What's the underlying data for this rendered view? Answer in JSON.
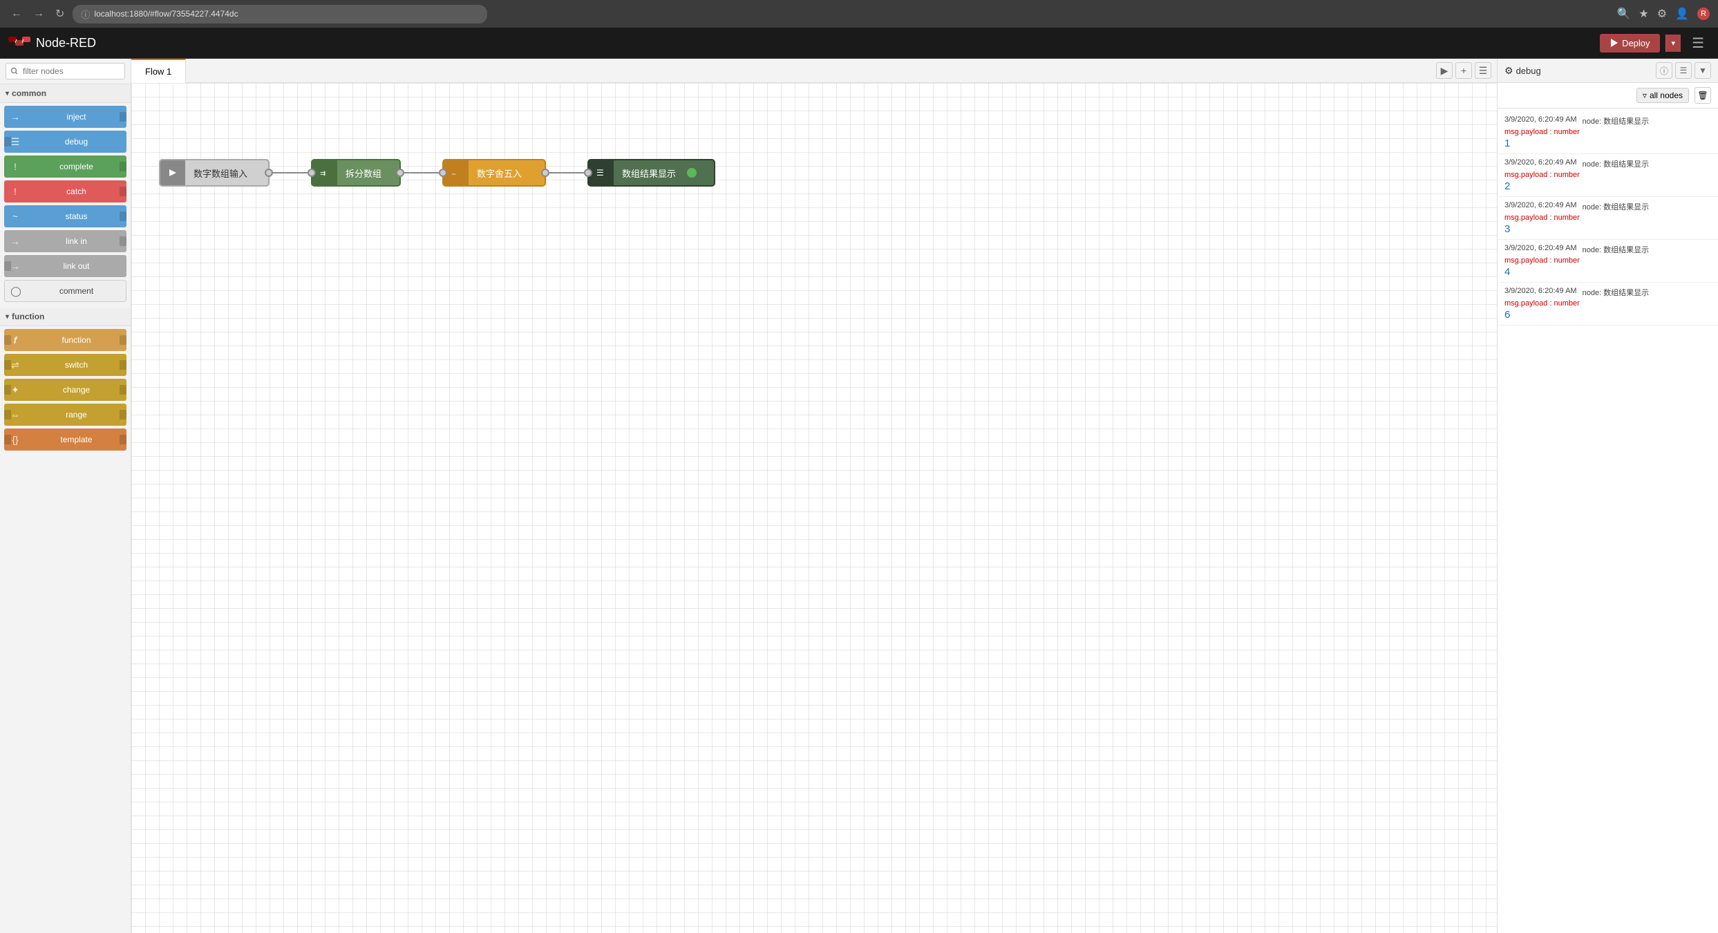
{
  "browser": {
    "url": "localhost:1880/#flow/73554227.4474dc",
    "back_label": "←",
    "forward_label": "→",
    "refresh_label": "↻"
  },
  "header": {
    "logo_text": "Node-RED",
    "deploy_label": "Deploy",
    "menu_label": "☰"
  },
  "sidebar": {
    "filter_placeholder": "filter nodes",
    "categories": [
      {
        "name": "common",
        "label": "common",
        "nodes": [
          {
            "id": "inject",
            "label": "inject",
            "color": "#5a9fd4",
            "icon": "→",
            "has_left": false,
            "has_right": true
          },
          {
            "id": "debug",
            "label": "debug",
            "color": "#5a9fd4",
            "icon": "≡",
            "has_left": true,
            "has_right": false
          },
          {
            "id": "complete",
            "label": "complete",
            "color": "#5ba05b",
            "icon": "!",
            "has_left": false,
            "has_right": true
          },
          {
            "id": "catch",
            "label": "catch",
            "color": "#e05a5a",
            "icon": "!",
            "has_left": false,
            "has_right": true
          },
          {
            "id": "status",
            "label": "status",
            "color": "#5a9fd4",
            "icon": "~",
            "has_left": false,
            "has_right": true
          },
          {
            "id": "link-in",
            "label": "link in",
            "color": "#aaaaaa",
            "icon": "→",
            "has_left": false,
            "has_right": true
          },
          {
            "id": "link-out",
            "label": "link out",
            "color": "#aaaaaa",
            "icon": "→",
            "has_left": true,
            "has_right": false
          },
          {
            "id": "comment",
            "label": "comment",
            "color": "#eeeeee",
            "icon": "○",
            "has_left": false,
            "has_right": false
          }
        ]
      },
      {
        "name": "function",
        "label": "function",
        "nodes": [
          {
            "id": "function",
            "label": "function",
            "color": "#d4a050",
            "icon": "ƒ",
            "has_left": true,
            "has_right": true
          },
          {
            "id": "switch",
            "label": "switch",
            "color": "#c4a030",
            "icon": "⇌",
            "has_left": true,
            "has_right": true
          },
          {
            "id": "change",
            "label": "change",
            "color": "#c4a030",
            "icon": "✦",
            "has_left": true,
            "has_right": true
          },
          {
            "id": "range",
            "label": "range",
            "color": "#c4a030",
            "icon": "⇔",
            "has_left": true,
            "has_right": true
          },
          {
            "id": "template",
            "label": "template",
            "color": "#d48040",
            "icon": "{}",
            "has_left": true,
            "has_right": true
          }
        ]
      }
    ]
  },
  "flow": {
    "tab_label": "Flow 1",
    "nodes": [
      {
        "id": "input-node",
        "label": "数字数组输入",
        "type": "input",
        "icon": "→",
        "has_left": false,
        "has_right": true
      },
      {
        "id": "split-node",
        "label": "拆分数组",
        "type": "split",
        "icon": "⇉",
        "has_left": true,
        "has_right": true
      },
      {
        "id": "round-node",
        "label": "数字舍五入",
        "type": "round",
        "icon": "⇔",
        "has_left": true,
        "has_right": true
      },
      {
        "id": "output-node",
        "label": "数组结果显示",
        "type": "output",
        "icon": "≡",
        "has_left": true,
        "has_right": false
      }
    ]
  },
  "debug_panel": {
    "title": "debug",
    "icon": "⚙",
    "all_nodes_label": "all nodes",
    "messages": [
      {
        "time": "3/9/2020, 6:20:49 AM",
        "node_label": "node: 数组结果显示",
        "type_label": "msg.payload : number",
        "value": "1"
      },
      {
        "time": "3/9/2020, 6:20:49 AM",
        "node_label": "node: 数组结果显示",
        "type_label": "msg.payload : number",
        "value": "2"
      },
      {
        "time": "3/9/2020, 6:20:49 AM",
        "node_label": "node: 数组结果显示",
        "type_label": "msg.payload : number",
        "value": "3"
      },
      {
        "time": "3/9/2020, 6:20:49 AM",
        "node_label": "node: 数组结果显示",
        "type_label": "msg.payload : number",
        "value": "4"
      },
      {
        "time": "3/9/2020, 6:20:49 AM",
        "node_label": "node: 数组结果显示",
        "type_label": "msg.payload : number",
        "value": "6"
      }
    ]
  },
  "colors": {
    "accent": "#e08000",
    "deploy_bg": "#aa4444",
    "header_bg": "#1a1a1a"
  }
}
